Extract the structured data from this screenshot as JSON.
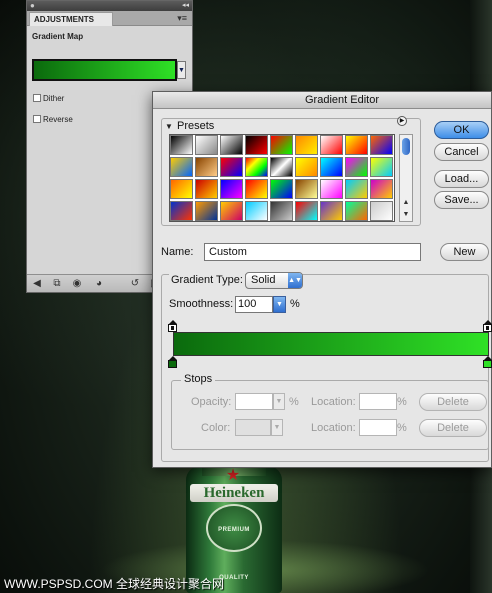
{
  "background": {
    "bottle_brand": "Heineken",
    "bottle_seal": "PREMIUM QUALITY",
    "watermark": "WWW.PSPSD.COM 全球经典设计聚合网"
  },
  "adjustments_panel": {
    "tab_label": "ADJUSTMENTS",
    "title": "Gradient Map",
    "gradient_colors": [
      "#0b6a0d",
      "#2fe126"
    ],
    "dither_label": "Dither",
    "reverse_label": "Reverse",
    "dither_checked": false,
    "reverse_checked": false,
    "bottom_icons": [
      "back-arrow-icon",
      "clip-layer-icon",
      "visibility-eye-icon",
      "view-previous-icon",
      "reset-icon",
      "trash-icon"
    ]
  },
  "gradient_editor": {
    "title": "Gradient Editor",
    "presets_label": "Presets",
    "buttons": {
      "ok": "OK",
      "cancel": "Cancel",
      "load": "Load...",
      "save": "Save...",
      "new": "New",
      "delete_opacity": "Delete",
      "delete_color": "Delete"
    },
    "name_label": "Name:",
    "name_value": "Custom",
    "gradient_type_label": "Gradient Type:",
    "gradient_type_value": "Solid",
    "smoothness_label": "Smoothness:",
    "smoothness_value": "100",
    "smoothness_unit": "%",
    "ramp_colors": [
      "#0b6a0d",
      "#2fe126"
    ],
    "stops_label": "Stops",
    "opacity_label": "Opacity:",
    "opacity_unit": "%",
    "location_label_1": "Location:",
    "location_unit_1": "%",
    "color_label": "Color:",
    "location_label_2": "Location:",
    "location_unit_2": "%",
    "swatches": [
      [
        "#000000,#ffffff",
        "#ffffff,#888888",
        "#ffffff,#000000",
        "#000000,#ff0000",
        "#ff0000,#00ff00",
        "#ff8800,#ffee00",
        "#ffffff,#ff0000",
        "#ffff00,#ff0000",
        "#ff6600,#0000ff"
      ],
      [
        "#ffcc00,#0066ff",
        "#884400,#ffcc88",
        "#ff0000,#0000ff",
        "#ff0000,#ffff00,#00ff00,#0000ff",
        "#000000,#ffffff,#000000",
        "#ffff00,#ff8800",
        "#00ffff,#0000ff",
        "#ff00ff,#00ff00",
        "#ffff00,#00ccff"
      ],
      [
        "#ff6600,#ffff00",
        "#cc0000,#ffcc00",
        "#0000ff,#ff00ff",
        "#ff0000,#ffff00",
        "#00ff00,#0000ff",
        "#884400,#ffff99",
        "#ffffff,#ff00ff",
        "#00ccff,#ffcc00",
        "#cc00cc,#ffcc00"
      ],
      [
        "#0033cc,#ff3300",
        "#ff9900,#003399",
        "#ffcc00,#cc0066",
        "#00ccff,#ffffff",
        "#333333,#cccccc",
        "#ff0000,#00ffff",
        "#6633cc,#ffcc00",
        "#00ff99,#ff6600",
        "#cccccc,#ffffff"
      ]
    ]
  }
}
